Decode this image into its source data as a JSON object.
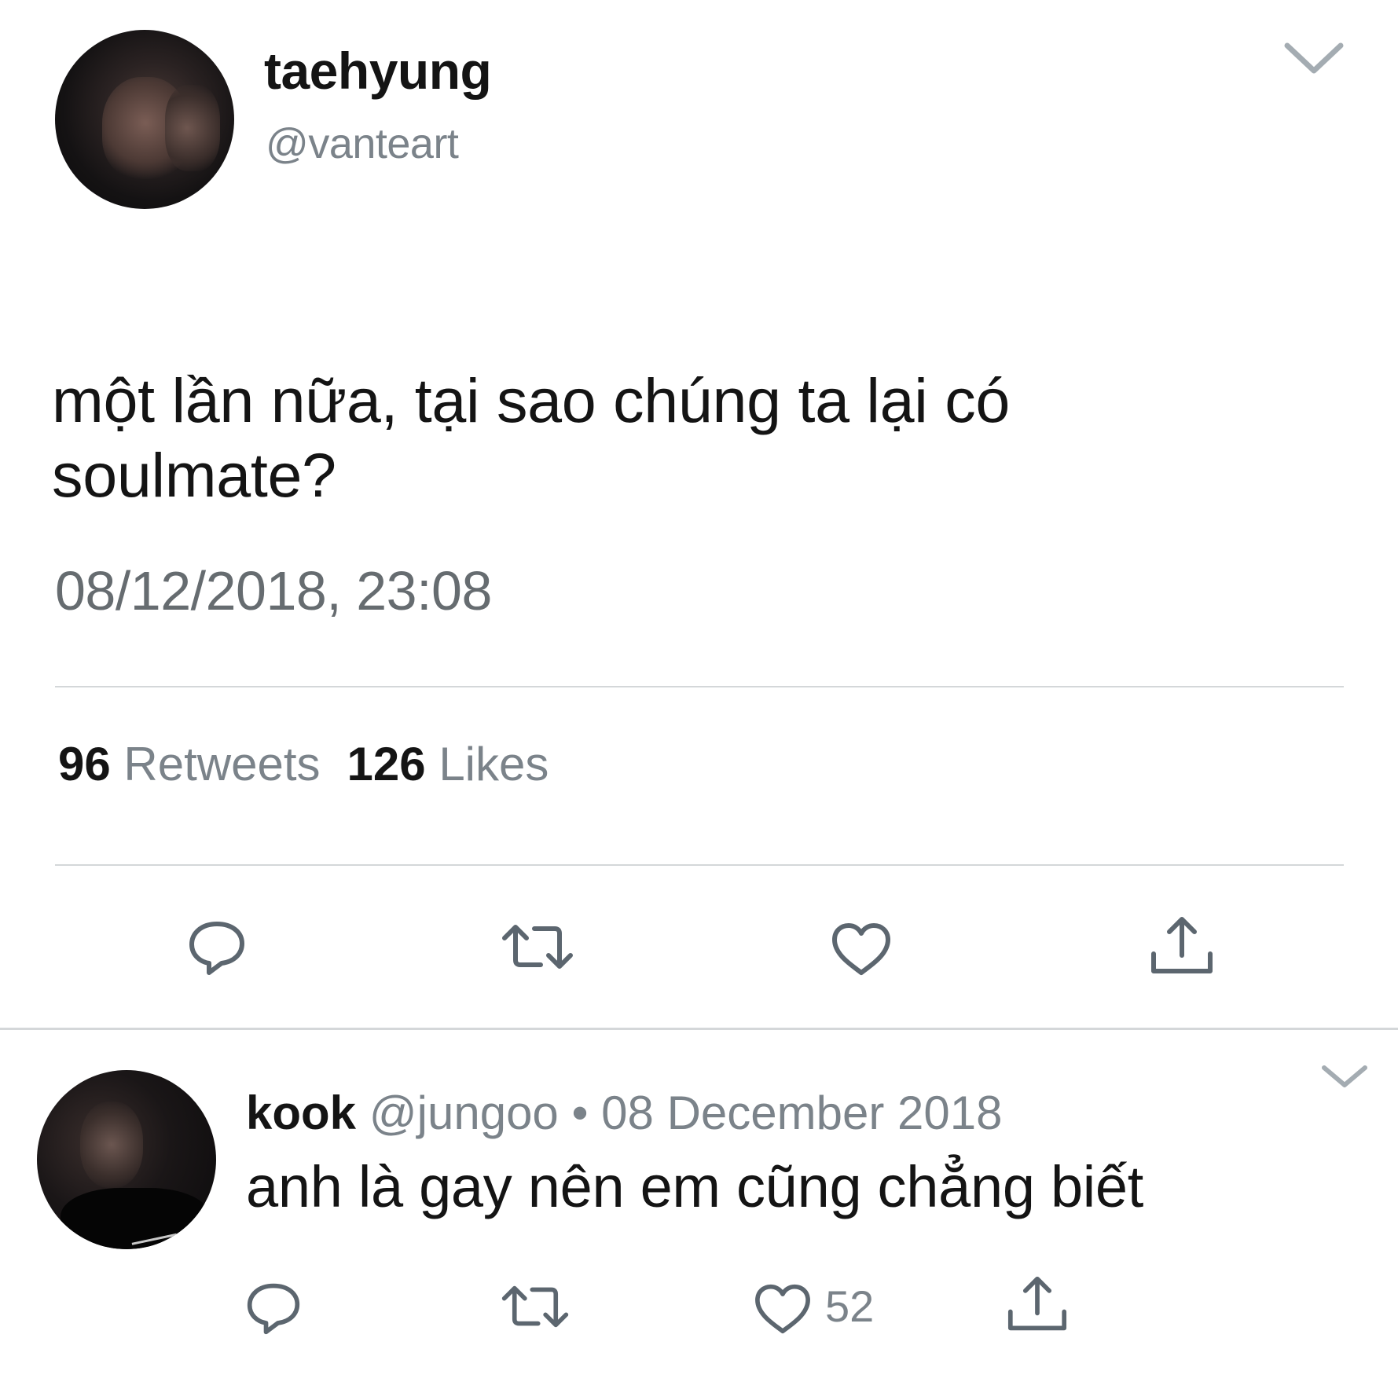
{
  "tweet": {
    "display_name": "taehyung",
    "handle": "@vanteart",
    "text": "một lần nữa, tại sao chúng ta lại có soulmate?",
    "timestamp": "08/12/2018, 23:08",
    "retweets_count": "96",
    "retweets_label": "Retweets",
    "likes_count": "126",
    "likes_label": "Likes",
    "icons": [
      "chevron-down-icon",
      "reply-icon",
      "retweet-icon",
      "like-icon",
      "share-icon"
    ]
  },
  "reply": {
    "display_name": "kook",
    "handle": "@jungoo",
    "separator": "•",
    "date": "08 December 2018",
    "text": "anh là gay nên em cũng chẳng biết",
    "like_count": "52",
    "icons": [
      "chevron-down-icon",
      "reply-icon",
      "retweet-icon",
      "like-icon",
      "share-icon"
    ]
  },
  "colors": {
    "text_primary": "#141414",
    "text_secondary": "#7b838a",
    "icon": "#5c666f",
    "divider": "#d4d7d9"
  }
}
